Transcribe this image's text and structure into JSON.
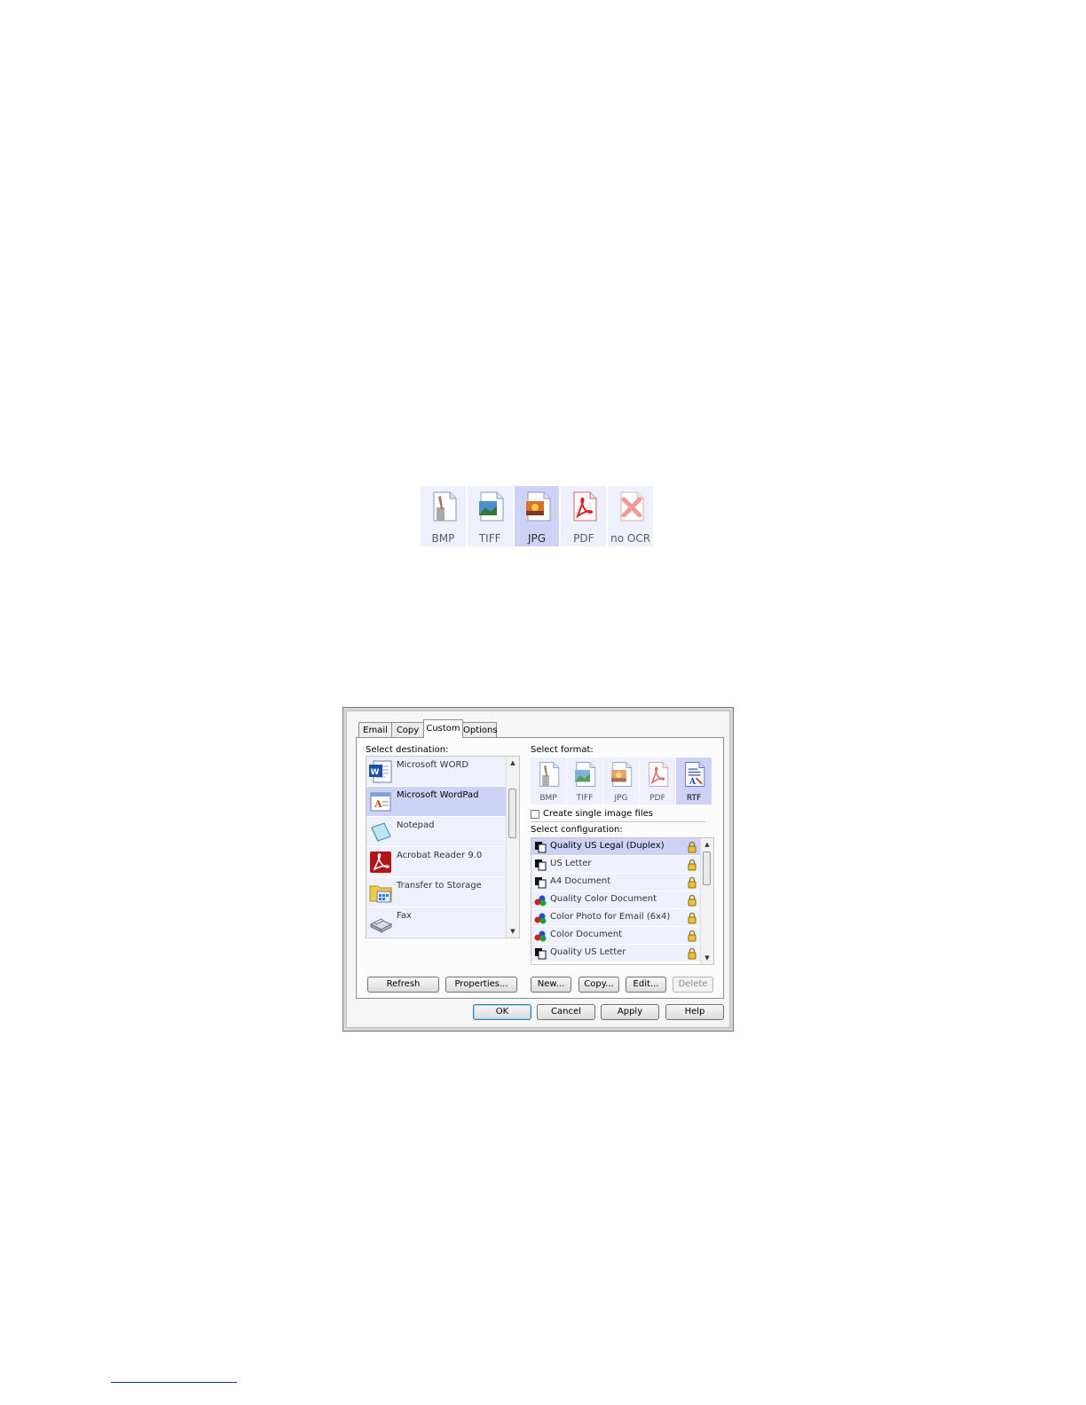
{
  "format_strip": {
    "items": [
      {
        "label": "BMP",
        "selected": false
      },
      {
        "label": "TIFF",
        "selected": false
      },
      {
        "label": "JPG",
        "selected": true
      },
      {
        "label": "PDF",
        "selected": false
      },
      {
        "label": "no OCR",
        "selected": false
      }
    ]
  },
  "dialog": {
    "tabs": [
      {
        "label": "Email",
        "active": false
      },
      {
        "label": "Copy",
        "active": false
      },
      {
        "label": "Custom",
        "active": true
      },
      {
        "label": "Options",
        "active": false
      }
    ],
    "destination": {
      "caption": "Select destination:",
      "items": [
        {
          "name": "Microsoft WORD",
          "icon": "word-icon",
          "selected": false
        },
        {
          "name": "Microsoft WordPad",
          "icon": "wordpad-icon",
          "selected": true
        },
        {
          "name": "Notepad",
          "icon": "notepad-icon",
          "selected": false
        },
        {
          "name": "Acrobat Reader 9.0",
          "icon": "acrobat-icon",
          "selected": false
        },
        {
          "name": "Transfer to Storage",
          "icon": "storage-folder-icon",
          "selected": false
        },
        {
          "name": "Fax",
          "icon": "fax-icon",
          "selected": false
        }
      ]
    },
    "format": {
      "caption": "Select format:",
      "items": [
        {
          "label": "BMP",
          "selected": false
        },
        {
          "label": "TIFF",
          "selected": false
        },
        {
          "label": "JPG",
          "selected": false
        },
        {
          "label": "PDF",
          "selected": false
        },
        {
          "label": "RTF",
          "selected": true
        }
      ],
      "single_image_label": "Create single image files",
      "single_image_checked": false
    },
    "configuration": {
      "caption": "Select configuration:",
      "items": [
        {
          "name": "Quality US Legal (Duplex)",
          "icon": "bw-document-icon",
          "selected": true
        },
        {
          "name": "US Letter",
          "icon": "bw-document-icon",
          "selected": false
        },
        {
          "name": "A4 Document",
          "icon": "bw-document-icon",
          "selected": false
        },
        {
          "name": "Quality Color Document",
          "icon": "color-document-icon",
          "selected": false
        },
        {
          "name": "Color Photo for Email (6x4)",
          "icon": "color-document-icon",
          "selected": false
        },
        {
          "name": "Color Document",
          "icon": "color-document-icon",
          "selected": false
        },
        {
          "name": "Quality US Letter",
          "icon": "bw-document-icon",
          "selected": false
        }
      ]
    },
    "buttons": {
      "refresh": "Refresh",
      "properties": "Properties...",
      "new": "New...",
      "copy": "Copy...",
      "edit": "Edit...",
      "delete": "Delete",
      "ok": "OK",
      "cancel": "Cancel",
      "apply": "Apply",
      "help": "Help"
    }
  },
  "colors": {
    "selected_bg": "#cfd2f7",
    "item_bg": "#eef0fb"
  }
}
